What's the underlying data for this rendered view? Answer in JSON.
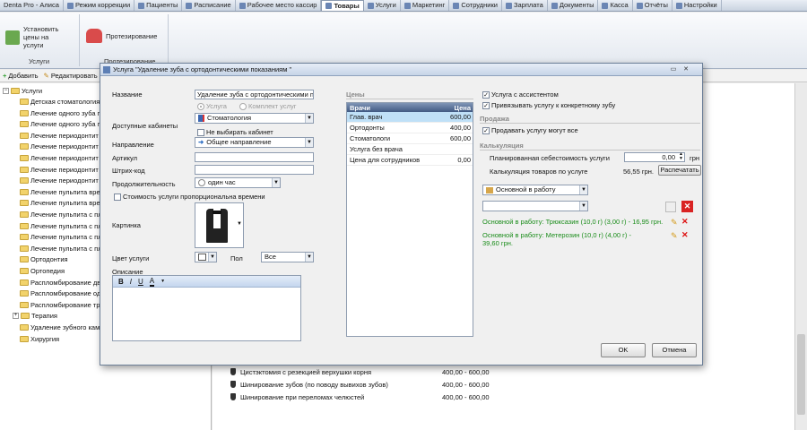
{
  "tabs": [
    "Denta Pro - Алиса",
    "Режим коррекции",
    "Пациенты",
    "Расписание",
    "Рабочее место кассир",
    "Товары",
    "Услуги",
    "Маркетинг",
    "Сотрудники",
    "Зарплата",
    "Документы",
    "Касса",
    "Отчёты",
    "Настройки"
  ],
  "ribbon": {
    "btn_set_prices": "Установить цены на услуги",
    "btn_prosthetics": "Протезирование",
    "group_services": "Услуги",
    "group_prosthetics": "Протезирование"
  },
  "toolbar": {
    "add": "Добавить",
    "edit": "Редактировать"
  },
  "tree": {
    "root": "Услуги",
    "items": [
      "Детская стоматология",
      "Лечение одного зуба п",
      "Лечение одного зуба п",
      "Лечение периодонтит",
      "Лечение периодонтит",
      "Лечение периодонтит",
      "Лечение периодонтит",
      "Лечение периодонтит",
      "Лечение пульпита врем",
      "Лечение пульпита врем",
      "Лечение пульпита с пл",
      "Лечение пульпита с пл",
      "Лечение пульпита с пл",
      "Лечение пульпита с пл",
      "Ортодонтия",
      "Ортопедия",
      "Распломбирование дв",
      "Распломбирование од",
      "Распломбирование тр",
      "Терапия",
      "Удаление зубного кам",
      "Хирургия"
    ]
  },
  "bg_rows": [
    {
      "name": "Цистэктомия с резекцией верхушки корня",
      "price": "400,00 - 600,00"
    },
    {
      "name": "Шинирование зубов (по поводу вывихов зубов)",
      "price": "400,00 - 600,00"
    },
    {
      "name": "Шинирование при переломах челюстей",
      "price": "400,00 - 600,00"
    }
  ],
  "dialog": {
    "title": "Услуга \"Удаление зуба с ортодонтическими показаниям \"",
    "name_label": "Название",
    "name_value": "Удаление зуба с ортодонтическими по",
    "radio_service": "Услуга",
    "radio_set": "Комплект услуг",
    "cabinets_label": "Доступные кабинеты",
    "cabinets_value": "Стоматология",
    "no_cabinet": "Не выбирать кабинет",
    "direction_label": "Направление",
    "direction_value": "Общее направление",
    "article_label": "Артикул",
    "barcode_label": "Штрих-код",
    "duration_label": "Продолжительность",
    "duration_value": "один час",
    "cost_prop": "Стоимость услуги пропорциональна времени",
    "picture_label": "Картинка",
    "color_label": "Цвет услуги",
    "sex_label": "Пол",
    "sex_value": "Все",
    "desc_label": "Описание",
    "prices_section": "Цены",
    "grid_head": {
      "doctor": "Врачи",
      "price": "Цена"
    },
    "grid_rows": [
      {
        "doctor": "Глав. врач",
        "price": "600,00"
      },
      {
        "doctor": "Ортодонты",
        "price": "400,00"
      },
      {
        "doctor": "Стоматологи",
        "price": "600,00"
      },
      {
        "doctor": "Услуга без врача",
        "price": ""
      },
      {
        "doctor": "Цена для сотрудников",
        "price": "0,00"
      }
    ],
    "chk_assistant": "Услуга с ассистентом",
    "chk_tooth": "Привязывать услугу к конкретному зубу",
    "sale_section": "Продажа",
    "chk_sale_all": "Продавать услугу могут все",
    "calc_section": "Калькуляция",
    "planned_cost_label": "Планированная себестоимость услуги",
    "planned_cost_value": "0,00",
    "currency": "грн",
    "calc_goods_label": "Калькуляция товаров по услуге",
    "calc_goods_value": "56,55 грн.",
    "print_btn": "Распечатать",
    "warehouse_value": "Основной  в работу",
    "item1": "Основной  в работу: Трюксазин (10,0 г) (3,00 г) - 16,95 грн.",
    "item2": "Основной  в работу: Метерозин (10,0 г) (4,00 г) - 39,60 грн.",
    "ok": "OK",
    "cancel": "Отмена"
  }
}
